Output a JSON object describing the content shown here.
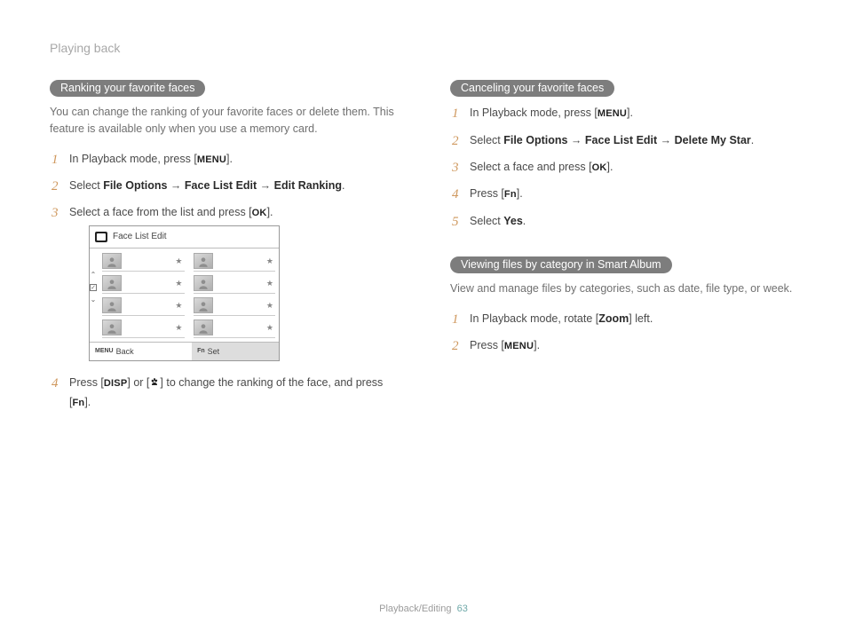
{
  "page_title": "Playing back",
  "left": {
    "heading": "Ranking your favorite faces",
    "intro": "You can change the ranking of your favorite faces or delete them. This feature is available only when you use a memory card.",
    "step1_a": "In Playback mode, press [",
    "step1_btn": "MENU",
    "step1_b": "].",
    "step2_a": "Select ",
    "step2_b": "File Options",
    "step2_c": " → ",
    "step2_d": "Face List Edit",
    "step2_e": " → ",
    "step2_f": "Edit Ranking",
    "step2_g": ".",
    "step3_a": "Select a face from the list and press [",
    "step3_btn": "OK",
    "step3_b": "].",
    "screen_title": "Face List Edit",
    "screen_back": "Back",
    "screen_back_btn": "MENU",
    "screen_set": "Set",
    "screen_set_btn": "Fn",
    "step4_a": "Press [",
    "step4_btn1": "DISP",
    "step4_b": "] or [",
    "step4_c": "] to change the ranking of the face, and press [",
    "step4_btn2": "Fn",
    "step4_d": "]."
  },
  "right": {
    "heading": "Canceling your favorite faces",
    "step1_a": "In Playback mode, press [",
    "step1_btn": "MENU",
    "step1_b": "].",
    "step2_a": "Select ",
    "step2_b": "File Options",
    "step2_c": " → ",
    "step2_d": "Face List Edit",
    "step2_e": " → ",
    "step2_f": "Delete My Star",
    "step2_g": ".",
    "step3_a": "Select a face and press [",
    "step3_btn": "OK",
    "step3_b": "].",
    "step4_a": "Press [",
    "step4_btn": "Fn",
    "step4_b": "].",
    "step5_a": "Select ",
    "step5_b": "Yes",
    "step5_c": ".",
    "sub_heading": "Viewing files by category in Smart Album",
    "sub_intro": "View and manage files by categories, such as date, file type, or week.",
    "sub_step1_a": "In Playback mode, rotate [",
    "sub_step1_b": "Zoom",
    "sub_step1_c": "] left.",
    "sub_step2_a": "Press [",
    "sub_step2_btn": "MENU",
    "sub_step2_b": "]."
  },
  "footer_section": "Playback/Editing",
  "footer_page": "63"
}
